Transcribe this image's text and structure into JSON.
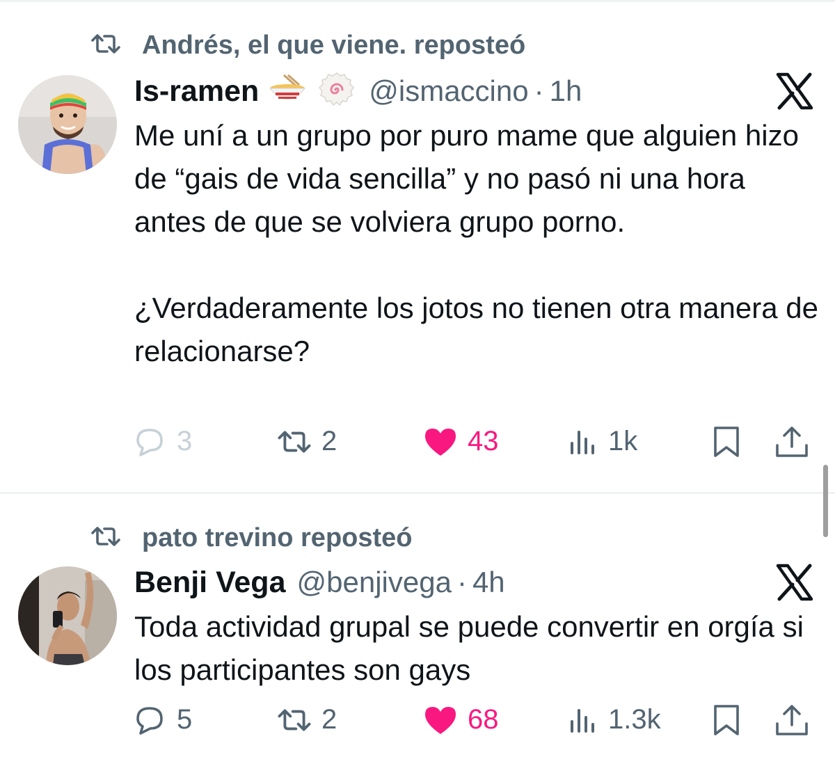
{
  "tweets": [
    {
      "repost_text": "Andrés, el que viene. reposteó",
      "display_name": "Is-ramen",
      "name_emojis": [
        "ramen-bowl-emoji",
        "fish-cake-emoji"
      ],
      "handle": "@ismaccino",
      "separator": "·",
      "time": "1h",
      "paragraphs": [
        "Me uní a un grupo por puro mame que alguien hizo de “gais de vida sencilla” y no pasó ni una hora antes de que se volviera grupo porno.",
        "¿Verdaderamente los jotos no tienen otra manera de relacionarse?"
      ],
      "replies": "3",
      "reposts": "2",
      "likes": "43",
      "views": "1k",
      "liked": true
    },
    {
      "repost_text": "pato trevino reposteó",
      "display_name": "Benji Vega",
      "handle": "@benjivega",
      "separator": "·",
      "time": "4h",
      "paragraphs": [
        "Toda actividad grupal se puede convertir en orgía si los participantes son gays"
      ],
      "replies": "5",
      "reposts": "2",
      "likes": "68",
      "views": "1.3k",
      "liked": true
    }
  ],
  "icons": {
    "repost": "repost-icon",
    "reply": "reply-icon",
    "like": "heart-icon",
    "views": "views-chart-icon",
    "bookmark": "bookmark-icon",
    "share": "share-icon",
    "platform": "x-logo-icon"
  },
  "colors": {
    "text": "#0f1419",
    "secondary": "#536471",
    "like_pink": "#f91880",
    "faded_reply": "#c7d1d8",
    "divider": "#eff1f3"
  }
}
